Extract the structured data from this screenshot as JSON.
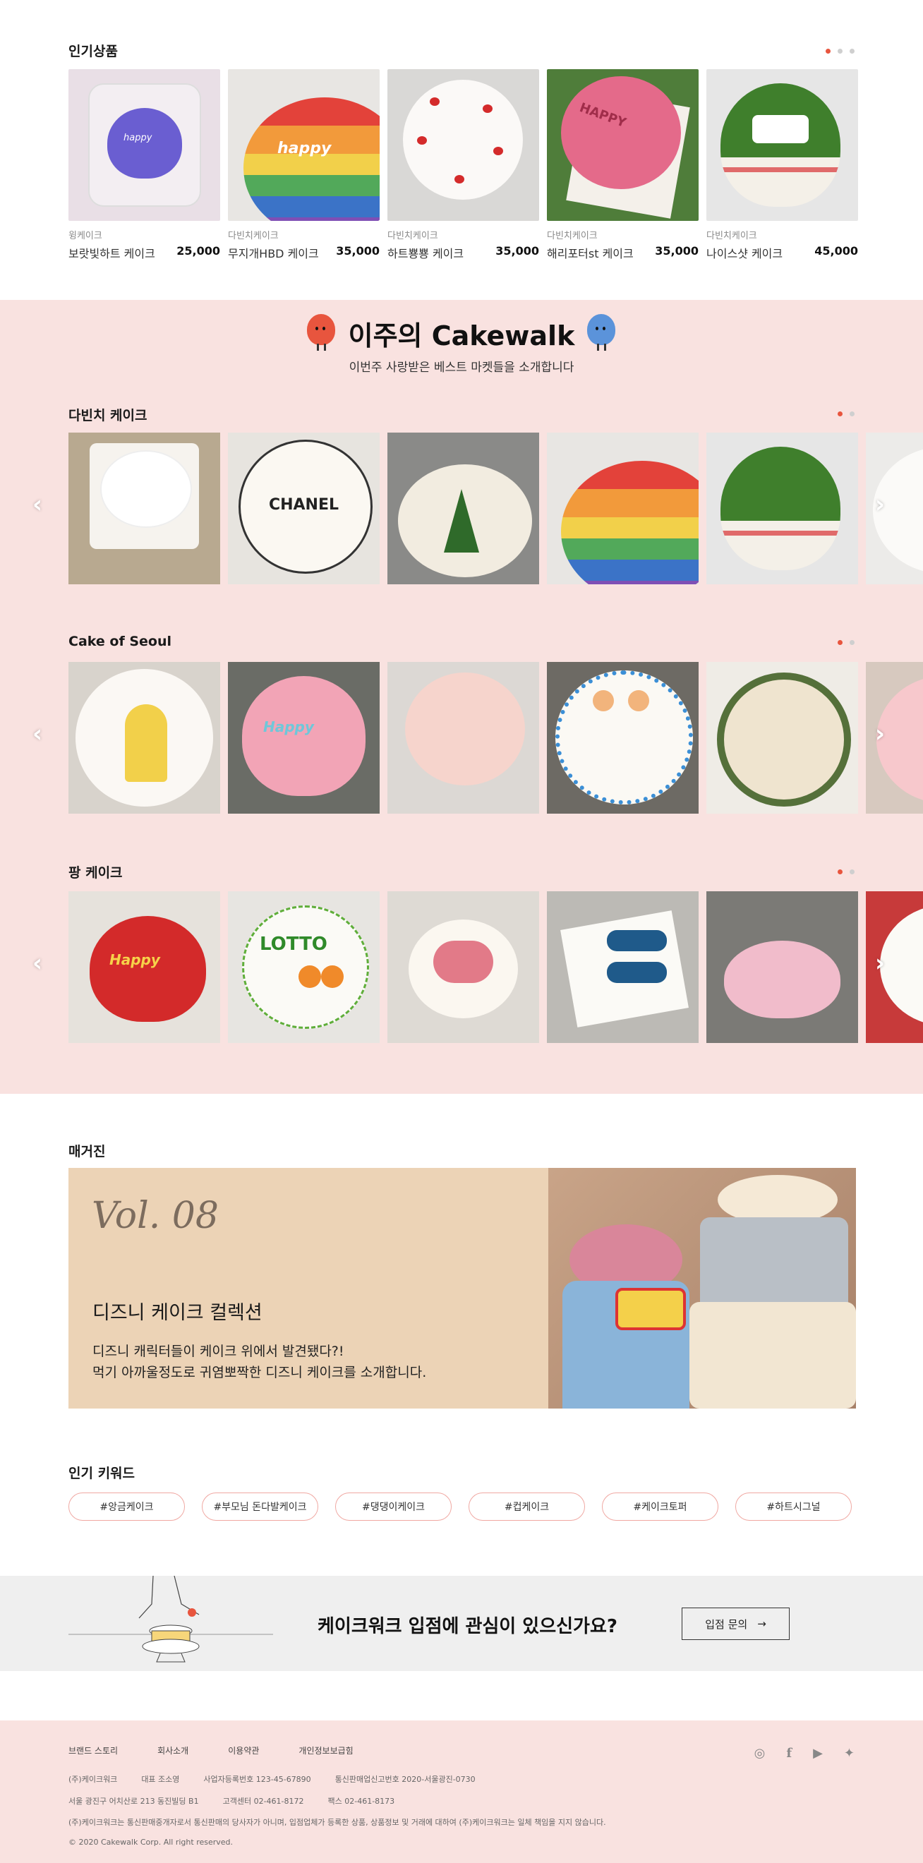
{
  "popular": {
    "title": "인기상품",
    "products": [
      {
        "shop": "윙케이크",
        "name": "보랏빛하트 케이크",
        "price": "25,000"
      },
      {
        "shop": "다빈치케이크",
        "name": "무지개HBD 케이크",
        "price": "35,000"
      },
      {
        "shop": "다빈치케이크",
        "name": "하트뿅뿅 케이크",
        "price": "35,000"
      },
      {
        "shop": "다빈치케이크",
        "name": "해리포터st 케이크",
        "price": "35,000"
      },
      {
        "shop": "다빈치케이크",
        "name": "나이스샷 케이크",
        "price": "45,000"
      }
    ]
  },
  "cakewalk": {
    "title": "이주의 Cakewalk",
    "subtitle": "이번주 사랑받은 베스트 마켓들을 소개합니다",
    "shops": [
      {
        "title": "다빈치 케이크"
      },
      {
        "title": "Cake of Seoul"
      },
      {
        "title": "팡 케이크"
      }
    ]
  },
  "magazine": {
    "title": "매거진",
    "vol": "Vol. 08",
    "headline": "디즈니 케이크 컬렉션",
    "desc1": "디즈니 캐릭터들이 케이크 위에서 발견됐다?!",
    "desc2": "먹기 아까울정도로 귀염뽀짝한 디즈니 케이크를 소개합니다."
  },
  "keywords": {
    "title": "인기 키워드",
    "items": [
      "#앙금케이크",
      "#부모님 돈다발케이크",
      "#댕댕이케이크",
      "#컵케이크",
      "#케이크토퍼",
      "#하트시그널"
    ]
  },
  "banner": {
    "text": "케이크워크 입점에 관심이 있으신가요?",
    "button": "입점 문의",
    "button_icon": "arrow-right-icon"
  },
  "footer": {
    "links": [
      "브랜드 스토리",
      "회사소개",
      "이용약관",
      "개인정보보급힘"
    ],
    "company": "(주)케이크워크",
    "ceo": "대표 조소영",
    "bizno": "사업자등록번호 123-45-67890",
    "mailorder": "통신판매업신고번호 2020-서울광진-0730",
    "address": "서울 광진구 어치산로 213 동진빌딩 B1",
    "tel": "고객센터 02-461-8172",
    "fax": "팩스 02-461-8173",
    "notice": "(주)케이크워크는 통신판매중개자로서 통신판매의 당사자가 아니며, 입점업체가 등록한 상품, 상품정보 및 거래에 대하여 (주)케이크워크는 일체 책임을 지지 않습니다.",
    "copyright": "© 2020 Cakewalk Corp. All right reserved.",
    "social": [
      "instagram-icon",
      "facebook-icon",
      "youtube-icon",
      "twitter-icon"
    ]
  },
  "colors": {
    "accent": "#e8553e",
    "band": "#f9e2e0",
    "keyword_border": "#f0a8a2",
    "magazine_bg": "#ecd3b6"
  }
}
